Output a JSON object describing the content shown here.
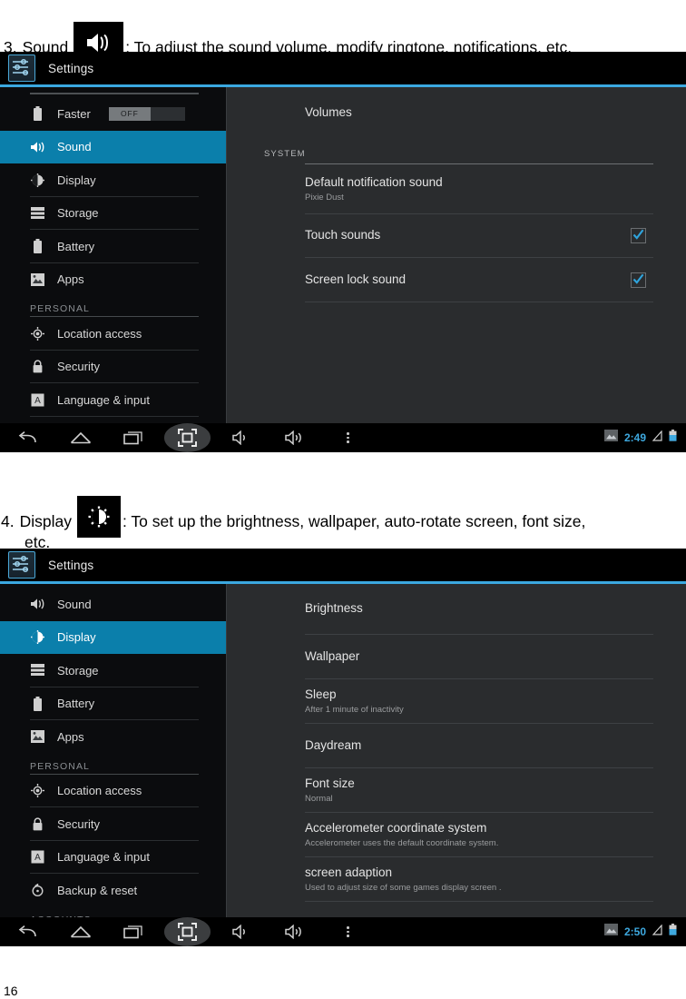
{
  "document": {
    "page_number": "16",
    "items": [
      {
        "number": "3.",
        "name": "Sound",
        "badge_icon": "speaker-icon",
        "description": ": To adjust the sound volume, modify ringtone, notifications, etc."
      },
      {
        "number": "4.",
        "name": "Display",
        "badge_icon": "brightness-icon",
        "description": ": To set up the brightness, wallpaper, auto-rotate screen, font size,",
        "description_line2": "etc."
      }
    ]
  },
  "colors": {
    "accent_blue": "#0b7fab",
    "rule_blue": "#3ba8e0",
    "status_time_blue": "#3ea9e0",
    "pane_bg": "#2a2c2e",
    "sidebar_bg": "#0b0c0e"
  },
  "screenshot_sound": {
    "title_bar": {
      "app_name": "Settings",
      "icon": "settings-sliders-icon"
    },
    "sidebar": {
      "items": [
        {
          "label": "Faster",
          "icon": "battery-icon",
          "selected": false,
          "toggle": "OFF",
          "divider": false
        },
        {
          "label": "Sound",
          "icon": "speaker-icon",
          "selected": true,
          "divider": false
        },
        {
          "label": "Display",
          "icon": "brightness-icon",
          "selected": false,
          "divider": true
        },
        {
          "label": "Storage",
          "icon": "storage-icon",
          "selected": false,
          "divider": true
        },
        {
          "label": "Battery",
          "icon": "battery-icon",
          "selected": false,
          "divider": true
        },
        {
          "label": "Apps",
          "icon": "apps-icon",
          "selected": false,
          "divider": false
        }
      ],
      "section_header": "PERSONAL",
      "items_personal": [
        {
          "label": "Location access",
          "icon": "location-icon",
          "divider": true
        },
        {
          "label": "Security",
          "icon": "lock-icon",
          "divider": true
        },
        {
          "label": "Language & input",
          "icon": "language-icon",
          "divider": true
        }
      ]
    },
    "pane": {
      "first_row": "Volumes",
      "section_header": "SYSTEM",
      "rows": [
        {
          "title": "Default notification sound",
          "subtitle": "Pixie Dust",
          "checkbox": false
        },
        {
          "title": "Touch sounds",
          "subtitle": "",
          "checkbox": true
        },
        {
          "title": "Screen lock sound",
          "subtitle": "",
          "checkbox": true
        }
      ]
    },
    "navbar": {
      "buttons": [
        "back-icon",
        "home-icon",
        "recents-icon",
        "fullscreen-icon",
        "volume-down-icon",
        "volume-up-icon",
        "overflow-menu-icon"
      ],
      "status": {
        "screenshot_icon": "image-icon",
        "time": "2:49",
        "signal_icon": "signal-icon",
        "battery_icon": "battery-icon"
      }
    }
  },
  "screenshot_display": {
    "title_bar": {
      "app_name": "Settings",
      "icon": "settings-sliders-icon"
    },
    "sidebar": {
      "items": [
        {
          "label": "Sound",
          "icon": "speaker-icon",
          "selected": false,
          "divider": false
        },
        {
          "label": "Display",
          "icon": "brightness-icon",
          "selected": true,
          "divider": false
        },
        {
          "label": "Storage",
          "icon": "storage-icon",
          "selected": false,
          "divider": true
        },
        {
          "label": "Battery",
          "icon": "battery-icon",
          "selected": false,
          "divider": true
        },
        {
          "label": "Apps",
          "icon": "apps-icon",
          "selected": false,
          "divider": false
        }
      ],
      "section_header": "PERSONAL",
      "items_personal": [
        {
          "label": "Location access",
          "icon": "location-icon",
          "divider": true
        },
        {
          "label": "Security",
          "icon": "lock-icon",
          "divider": true
        },
        {
          "label": "Language & input",
          "icon": "language-icon",
          "divider": true
        },
        {
          "label": "Backup & reset",
          "icon": "backup-icon",
          "divider": false
        }
      ],
      "section_header_2": "ACCOUNTS"
    },
    "pane": {
      "rows": [
        {
          "title": "Brightness",
          "subtitle": ""
        },
        {
          "title": "Wallpaper",
          "subtitle": ""
        },
        {
          "title": "Sleep",
          "subtitle": "After 1 minute of inactivity"
        },
        {
          "title": "Daydream",
          "subtitle": ""
        },
        {
          "title": "Font size",
          "subtitle": "Normal"
        },
        {
          "title": "Accelerometer coordinate system",
          "subtitle": "Accelerometer uses the default coordinate system."
        },
        {
          "title": "screen adaption",
          "subtitle": "Used to adjust size of some games display screen ."
        }
      ]
    },
    "navbar": {
      "buttons": [
        "back-icon",
        "home-icon",
        "recents-icon",
        "fullscreen-icon",
        "volume-down-icon",
        "volume-up-icon",
        "overflow-menu-icon"
      ],
      "status": {
        "screenshot_icon": "image-icon",
        "time": "2:50",
        "signal_icon": "signal-icon",
        "battery_icon": "battery-icon"
      }
    }
  }
}
